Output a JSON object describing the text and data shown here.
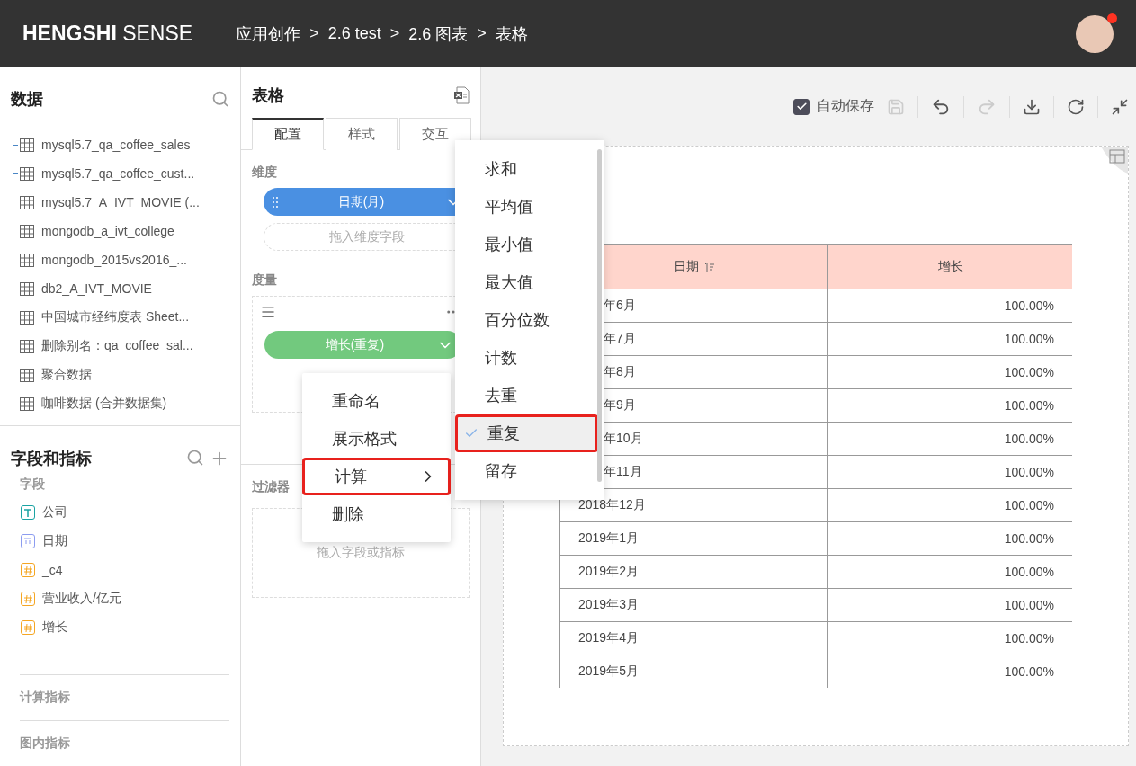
{
  "header": {
    "logo": {
      "strong": "HENGSHI",
      "light": "SENSE"
    },
    "breadcrumb": [
      "应用创作",
      "2.6 test",
      "2.6 图表",
      "表格"
    ],
    "separator": ">",
    "avatar_notification": true
  },
  "data_panel": {
    "title": "数据",
    "datasets": [
      {
        "name": "mysql5.7_qa_coffee_sales",
        "joined": true
      },
      {
        "name": "mysql5.7_qa_coffee_cust...",
        "joined": true
      },
      {
        "name": "mysql5.7_A_IVT_MOVIE (...",
        "joined": false
      },
      {
        "name": "mongodb_a_ivt_college",
        "joined": false
      },
      {
        "name": "mongodb_2015vs2016_...",
        "joined": false
      },
      {
        "name": "db2_A_IVT_MOVIE",
        "joined": false
      },
      {
        "name": "中国城市经纬度表 Sheet...",
        "joined": false
      },
      {
        "name": "删除别名：qa_coffee_sal...",
        "joined": false
      },
      {
        "name": "聚合数据",
        "joined": false
      },
      {
        "name": "咖啡数据 (合并数据集)",
        "joined": false
      }
    ]
  },
  "fields_panel": {
    "title": "字段和指标",
    "fields_label": "字段",
    "fields": [
      {
        "name": "公司",
        "kind": "text"
      },
      {
        "name": "日期",
        "kind": "date"
      },
      {
        "name": "_c4",
        "kind": "number"
      },
      {
        "name": "营业收入/亿元",
        "kind": "number"
      },
      {
        "name": "增长",
        "kind": "number"
      }
    ],
    "calculated_label": "计算指标",
    "chart_metrics_label": "图内指标"
  },
  "config_panel": {
    "title": "表格",
    "tabs": [
      {
        "label": "配置",
        "selected": true
      },
      {
        "label": "样式",
        "selected": false
      },
      {
        "label": "交互",
        "selected": false
      }
    ],
    "dimension_label": "维度",
    "dimension_pill": "日期(月)",
    "dimension_placeholder": "拖入维度字段",
    "measure_label": "度量",
    "measure_pill": "增长(重复)",
    "filter_label": "过滤器",
    "filter_placeholder": "拖入字段或指标"
  },
  "context_menu": [
    {
      "label": "重命名",
      "has_submenu": false,
      "highlighted": false
    },
    {
      "label": "展示格式",
      "has_submenu": false,
      "highlighted": false
    },
    {
      "label": "计算",
      "has_submenu": true,
      "highlighted": true
    },
    {
      "label": "删除",
      "has_submenu": false,
      "highlighted": false
    }
  ],
  "submenu": [
    {
      "label": "求和",
      "selected": false
    },
    {
      "label": "平均值",
      "selected": false
    },
    {
      "label": "最小值",
      "selected": false
    },
    {
      "label": "最大值",
      "selected": false
    },
    {
      "label": "百分位数",
      "selected": false
    },
    {
      "label": "计数",
      "selected": false
    },
    {
      "label": "去重",
      "selected": false
    },
    {
      "label": "重复",
      "selected": true
    },
    {
      "label": "留存",
      "selected": false
    }
  ],
  "toolbar": {
    "autosave": {
      "label": "自动保存",
      "checked": true
    }
  },
  "table": {
    "columns": [
      "日期",
      "增长"
    ],
    "rows": [
      {
        "date": "年6月",
        "value": "100.00%",
        "partial": true
      },
      {
        "date": "年7月",
        "value": "100.00%",
        "partial": true
      },
      {
        "date": "年8月",
        "value": "100.00%",
        "partial": true
      },
      {
        "date": "年9月",
        "value": "100.00%",
        "partial": true
      },
      {
        "date": "年10月",
        "value": "100.00%",
        "partial": true
      },
      {
        "date": "年11月",
        "value": "100.00%",
        "partial": true
      },
      {
        "date": "2018年12月",
        "value": "100.00%",
        "partial": false
      },
      {
        "date": "2019年1月",
        "value": "100.00%",
        "partial": false
      },
      {
        "date": "2019年2月",
        "value": "100.00%",
        "partial": false
      },
      {
        "date": "2019年3月",
        "value": "100.00%",
        "partial": false
      },
      {
        "date": "2019年4月",
        "value": "100.00%",
        "partial": false
      },
      {
        "date": "2019年5月",
        "value": "100.00%",
        "partial": false
      }
    ]
  }
}
